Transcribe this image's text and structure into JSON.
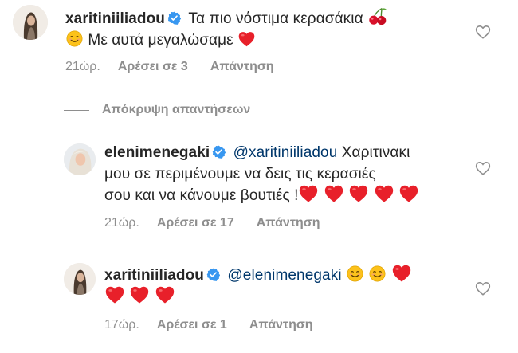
{
  "comments": [
    {
      "username": "xaritiniiliadou",
      "text_line1": "Τα πιο νόστιμα κερασάκια",
      "text_line2": "Με αυτά μεγαλώσαμε",
      "time": "21ώρ.",
      "likes": "Αρέσει σε 3",
      "reply": "Απάντηση",
      "icons": [
        "verified-badge",
        "cherry-emoji",
        "smiling-emoji",
        "red-heart-emoji",
        "heart-outline-like"
      ]
    },
    {
      "username": "elenimenegaki",
      "mention": "@xaritiniiliadou",
      "text_line1": "Χαριτινακι",
      "text_line2": "μου σε περιμένουμε να δεις τις κερασιές",
      "text_line3": "σου και να κάνουμε βουτιές !",
      "time": "21ώρ.",
      "likes": "Αρέσει σε 17",
      "reply": "Απάντηση",
      "icons": [
        "verified-badge",
        "red-heart-emoji",
        "heart-outline-like"
      ]
    },
    {
      "username": "xaritiniiliadou",
      "mention": "@elenimenegaki",
      "time": "17ώρ.",
      "likes": "Αρέσει σε 1",
      "reply": "Απάντηση",
      "icons": [
        "verified-badge",
        "smiling-emoji",
        "red-heart-emoji",
        "heart-outline-like"
      ]
    }
  ],
  "hide_replies": "Απόκρυψη απαντήσεων",
  "colors": {
    "text": "#262626",
    "meta": "#8e8e8e",
    "mention": "#00376b",
    "verified": "#3897f0",
    "heart": "#e8202a"
  }
}
